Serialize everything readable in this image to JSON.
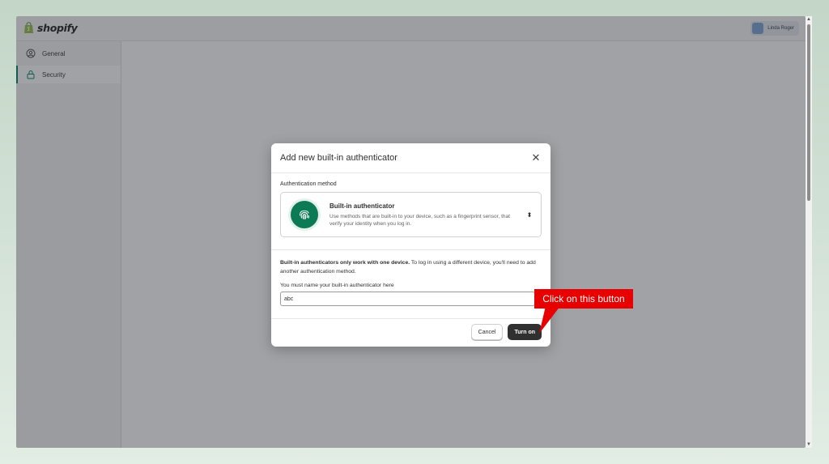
{
  "app": {
    "logo_text": "shopify",
    "user_name": "Linda Roger"
  },
  "sidebar": {
    "items": [
      {
        "label": "General",
        "icon": "person-circle-icon",
        "active": false
      },
      {
        "label": "Security",
        "icon": "lock-icon",
        "active": true
      }
    ]
  },
  "modal": {
    "title": "Add new built-in authenticator",
    "close_icon": "close-icon",
    "method_label": "Authentication method",
    "method": {
      "icon": "fingerprint-icon",
      "title": "Built-in authenticator",
      "description": "Use methods that are built-in to your device, such as a fingerprint sensor, that verify your identity when you log in.",
      "select_icon": "select-chevron-icon"
    },
    "info_bold": "Built-in authenticators only work with one device.",
    "info_rest": " To log in using a different device, you'll need to add another authentication method.",
    "name_label": "You must name your built-in authenticator here",
    "name_value": "abc",
    "cancel_label": "Cancel",
    "turn_on_label": "Turn on"
  },
  "annotation": {
    "callout_text": "Click on this button"
  },
  "colors": {
    "brand_green": "#008060",
    "fingerprint_bg": "#0c7a55",
    "primary_button": "#303030",
    "callout_red": "#e80000"
  }
}
